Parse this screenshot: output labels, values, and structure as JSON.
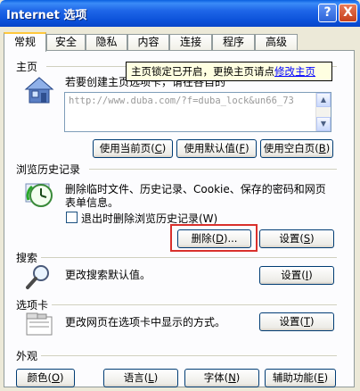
{
  "window": {
    "title": "Internet 选项",
    "help_label": "?",
    "close_label": "X"
  },
  "tabs": [
    {
      "label": "常规",
      "active": true
    },
    {
      "label": "安全"
    },
    {
      "label": "隐私"
    },
    {
      "label": "内容"
    },
    {
      "label": "连接"
    },
    {
      "label": "程序"
    },
    {
      "label": "高级"
    }
  ],
  "home": {
    "label": "主页",
    "description": "若要创建主页选项卡，请在各自的",
    "url": "http://www.duba.com/?f=duba_lock&un66_73",
    "tooltip_text": "主页锁定已开启，更换主页请点",
    "tooltip_link": "修改主页",
    "buttons": [
      {
        "text": "使用当前页(",
        "key": "C",
        "suffix": ")"
      },
      {
        "text": "使用默认值(",
        "key": "F",
        "suffix": ")"
      },
      {
        "text": "使用空白页(",
        "key": "B",
        "suffix": ")"
      }
    ]
  },
  "history": {
    "label": "浏览历史记录",
    "description_line1": "删除临时文件、历史记录、Cookie、保存的密码和网页",
    "description_line2": "表单信息。",
    "checkbox_label": "退出时删除浏览历史记录(W)",
    "checkbox_checked": false,
    "delete_button": {
      "text": "删除(",
      "key": "D",
      "suffix": ")..."
    },
    "settings_button": {
      "text": "设置(",
      "key": "S",
      "suffix": ")"
    }
  },
  "search": {
    "label": "搜索",
    "description": "更改搜索默认值。",
    "settings_button": {
      "text": "设置(",
      "key": "I",
      "suffix": ")"
    }
  },
  "tabs_section": {
    "label": "选项卡",
    "description": "更改网页在选项卡中显示的方式。",
    "settings_button": {
      "text": "设置(",
      "key": "T",
      "suffix": ")"
    }
  },
  "appearance": {
    "label": "外观",
    "buttons": [
      {
        "text": "颜色(",
        "key": "O",
        "suffix": ")"
      },
      {
        "text": "语言(",
        "key": "L",
        "suffix": ")"
      },
      {
        "text": "字体(",
        "key": "N",
        "suffix": ")"
      },
      {
        "text": "辅助功能(",
        "key": "E",
        "suffix": ")"
      }
    ]
  },
  "colors": {
    "title_bar": "#0a4fd8",
    "dialog_bg": "#ece9d8",
    "active_tab_accent": "#ffc83c",
    "highlight_box": "#d9302c",
    "tooltip_bg": "#ffffe1",
    "link": "#0000ff"
  },
  "icons": {
    "home": "house-icon",
    "history": "clock-icon",
    "search": "magnifier-icon",
    "tabs": "tabbed-window-icon"
  }
}
